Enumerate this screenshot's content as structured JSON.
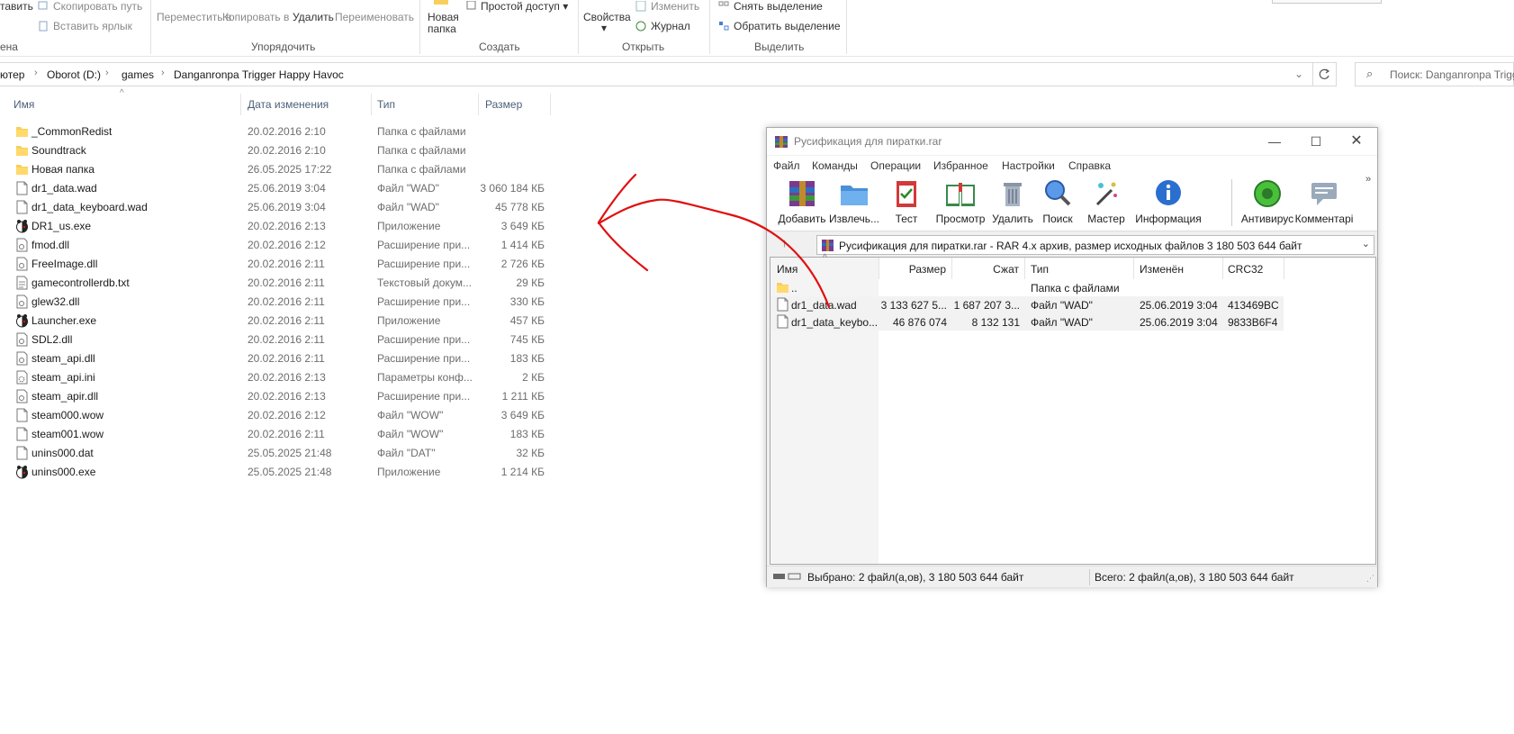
{
  "ribbon": {
    "paste_label": "тавить",
    "copy_path": "Скопировать путь",
    "paste_shortcut": "Вставить ярлык",
    "clipboard_group": "ена",
    "move_to": "Переместить в",
    "copy_to": "Копировать в",
    "delete": "Удалить",
    "rename": "Переименовать",
    "organize_group": "Упорядочить",
    "new_folder_1": "Новая",
    "new_folder_2": "папка",
    "easy_access": "Простой доступ",
    "create_group": "Создать",
    "properties": "Свойства",
    "edit": "Изменить",
    "history": "Журнал",
    "open_group": "Открыть",
    "select_none": "Снять выделение",
    "invert_selection": "Обратить выделение",
    "select_group": "Выделить"
  },
  "address": {
    "crumbs": [
      "ютер",
      "Oborot (D:)",
      "games",
      "Danganronpa Trigger Happy Havoc"
    ],
    "search_placeholder": "Поиск: Danganronpa Trigg"
  },
  "explorer": {
    "columns": {
      "name": "Имя",
      "date": "Дата изменения",
      "type": "Тип",
      "size": "Размер"
    },
    "files": [
      {
        "name": "_CommonRedist",
        "date": "20.02.2016 2:10",
        "type": "Папка с файлами",
        "size": "",
        "icon": "folder"
      },
      {
        "name": "Soundtrack",
        "date": "20.02.2016 2:10",
        "type": "Папка с файлами",
        "size": "",
        "icon": "folder"
      },
      {
        "name": "Новая папка",
        "date": "26.05.2025 17:22",
        "type": "Папка с файлами",
        "size": "",
        "icon": "folder"
      },
      {
        "name": "dr1_data.wad",
        "date": "25.06.2019 3:04",
        "type": "Файл \"WAD\"",
        "size": "3 060 184 КБ",
        "icon": "file"
      },
      {
        "name": "dr1_data_keyboard.wad",
        "date": "25.06.2019 3:04",
        "type": "Файл \"WAD\"",
        "size": "45 778 КБ",
        "icon": "file"
      },
      {
        "name": "DR1_us.exe",
        "date": "20.02.2016 2:13",
        "type": "Приложение",
        "size": "3 649 КБ",
        "icon": "exe"
      },
      {
        "name": "fmod.dll",
        "date": "20.02.2016 2:12",
        "type": "Расширение при...",
        "size": "1 414 КБ",
        "icon": "dll"
      },
      {
        "name": "FreeImage.dll",
        "date": "20.02.2016 2:11",
        "type": "Расширение при...",
        "size": "2 726 КБ",
        "icon": "dll"
      },
      {
        "name": "gamecontrollerdb.txt",
        "date": "20.02.2016 2:11",
        "type": "Текстовый докум...",
        "size": "29 КБ",
        "icon": "txt"
      },
      {
        "name": "glew32.dll",
        "date": "20.02.2016 2:11",
        "type": "Расширение при...",
        "size": "330 КБ",
        "icon": "dll"
      },
      {
        "name": "Launcher.exe",
        "date": "20.02.2016 2:11",
        "type": "Приложение",
        "size": "457 КБ",
        "icon": "exe"
      },
      {
        "name": "SDL2.dll",
        "date": "20.02.2016 2:11",
        "type": "Расширение при...",
        "size": "745 КБ",
        "icon": "dll"
      },
      {
        "name": "steam_api.dll",
        "date": "20.02.2016 2:11",
        "type": "Расширение при...",
        "size": "183 КБ",
        "icon": "dll"
      },
      {
        "name": "steam_api.ini",
        "date": "20.02.2016 2:13",
        "type": "Параметры конф...",
        "size": "2 КБ",
        "icon": "ini"
      },
      {
        "name": "steam_apir.dll",
        "date": "20.02.2016 2:13",
        "type": "Расширение при...",
        "size": "1 211 КБ",
        "icon": "dll"
      },
      {
        "name": "steam000.wow",
        "date": "20.02.2016 2:12",
        "type": "Файл \"WOW\"",
        "size": "3 649 КБ",
        "icon": "file"
      },
      {
        "name": "steam001.wow",
        "date": "20.02.2016 2:11",
        "type": "Файл \"WOW\"",
        "size": "183 КБ",
        "icon": "file"
      },
      {
        "name": "unins000.dat",
        "date": "25.05.2025 21:48",
        "type": "Файл \"DAT\"",
        "size": "32 КБ",
        "icon": "file"
      },
      {
        "name": "unins000.exe",
        "date": "25.05.2025 21:48",
        "type": "Приложение",
        "size": "1 214 КБ",
        "icon": "exe"
      }
    ]
  },
  "rar": {
    "title": "Русификация для пиратки.rar",
    "menu": [
      "Файл",
      "Команды",
      "Операции",
      "Избранное",
      "Настройки",
      "Справка"
    ],
    "toolbar": [
      "Добавить",
      "Извлечь...",
      "Тест",
      "Просмотр",
      "Удалить",
      "Поиск",
      "Мастер",
      "Информация",
      "Антивирус",
      "Комментарі"
    ],
    "path": "Русификация для пиратки.rar - RAR 4.x архив, размер исходных файлов 3 180 503 644 байт",
    "columns": {
      "name": "Имя",
      "size": "Размер",
      "packed": "Сжат",
      "type": "Тип",
      "modified": "Изменён",
      "crc": "CRC32"
    },
    "rows": [
      {
        "name": "..",
        "size": "",
        "packed": "",
        "type": "Папка с файлами",
        "modified": "",
        "crc": "",
        "icon": "folder"
      },
      {
        "name": "dr1_data.wad",
        "size": "3 133 627 5...",
        "packed": "1 687 207 3...",
        "type": "Файл \"WAD\"",
        "modified": "25.06.2019 3:04",
        "crc": "413469BC",
        "icon": "file"
      },
      {
        "name": "dr1_data_keybo...",
        "size": "46 876 074",
        "packed": "8 132 131",
        "type": "Файл \"WAD\"",
        "modified": "25.06.2019 3:04",
        "crc": "9833B6F4",
        "icon": "file"
      }
    ],
    "status_selected": "Выбрано: 2 файл(а,ов), 3 180 503 644 байт",
    "status_total": "Всего: 2 файл(а,ов), 3 180 503 644 байт"
  },
  "colors": {
    "annotation": "#e01010",
    "folder": "#f7cf5a",
    "header_text": "#4c607a"
  }
}
